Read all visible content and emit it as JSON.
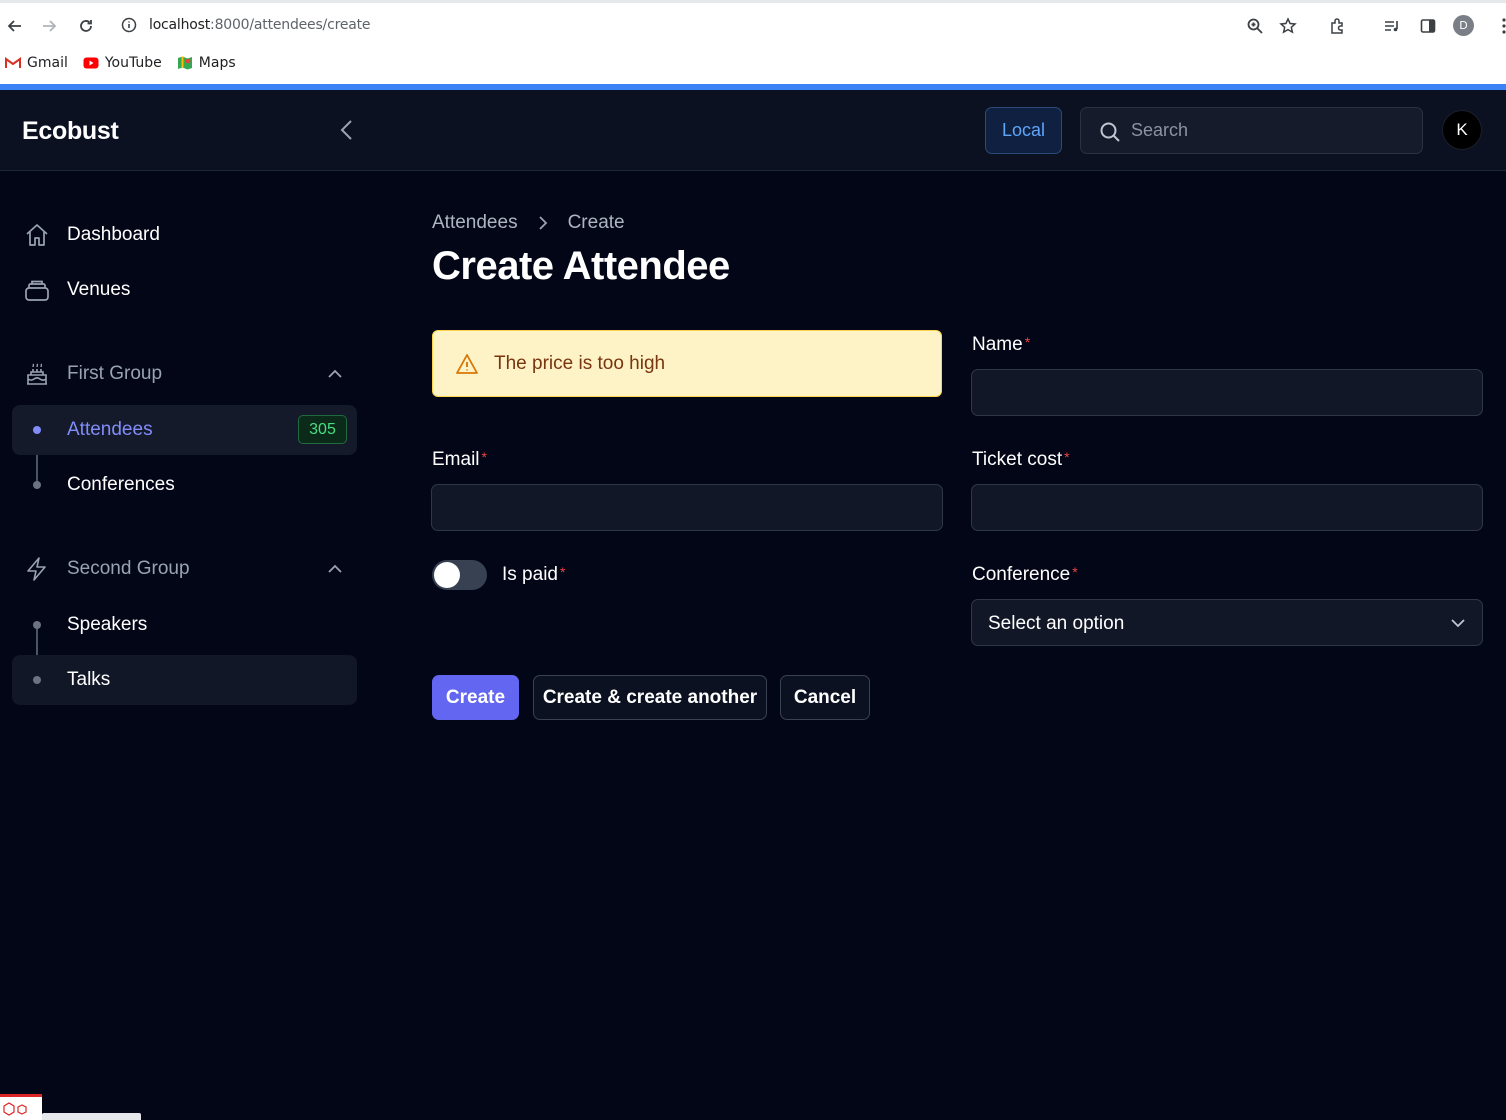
{
  "browser": {
    "url_host": "localhost",
    "url_rest": ":8000/attendees/create",
    "profile_initial": "D",
    "bookmarks": [
      {
        "label": "Gmail",
        "icon": "gmail-icon"
      },
      {
        "label": "YouTube",
        "icon": "youtube-icon"
      },
      {
        "label": "Maps",
        "icon": "maps-icon"
      }
    ]
  },
  "header": {
    "brand": "Ecobust",
    "env_badge": "Local",
    "search_placeholder": "Search",
    "avatar_initial": "K"
  },
  "sidebar": {
    "items": [
      {
        "label": "Dashboard",
        "icon": "home-icon"
      },
      {
        "label": "Venues",
        "icon": "stack-icon"
      }
    ],
    "groups": [
      {
        "label": "First Group",
        "icon": "cake-icon",
        "items": [
          {
            "label": "Attendees",
            "badge": "305",
            "active": true
          },
          {
            "label": "Conferences"
          }
        ]
      },
      {
        "label": "Second Group",
        "icon": "bolt-icon",
        "items": [
          {
            "label": "Speakers"
          },
          {
            "label": "Talks"
          }
        ]
      }
    ]
  },
  "main": {
    "breadcrumb": [
      "Attendees",
      "Create"
    ],
    "title": "Create Attendee",
    "alert": "The price is too high",
    "fields": {
      "name": {
        "label": "Name",
        "required": "*",
        "value": ""
      },
      "email": {
        "label": "Email",
        "required": "*",
        "value": ""
      },
      "ticket_cost": {
        "label": "Ticket cost",
        "required": "*",
        "value": ""
      },
      "is_paid": {
        "label": "Is paid",
        "required": "*",
        "checked": false
      },
      "conference": {
        "label": "Conference",
        "required": "*",
        "placeholder": "Select an option"
      }
    },
    "buttons": {
      "create": "Create",
      "create_another": "Create & create another",
      "cancel": "Cancel"
    }
  },
  "colors": {
    "background": "#030617",
    "accent": "#6366f1",
    "active_nav": "#818cf8",
    "badge_green": "#4ade80",
    "alert_bg": "#fef3c7",
    "required": "#ef4444"
  }
}
